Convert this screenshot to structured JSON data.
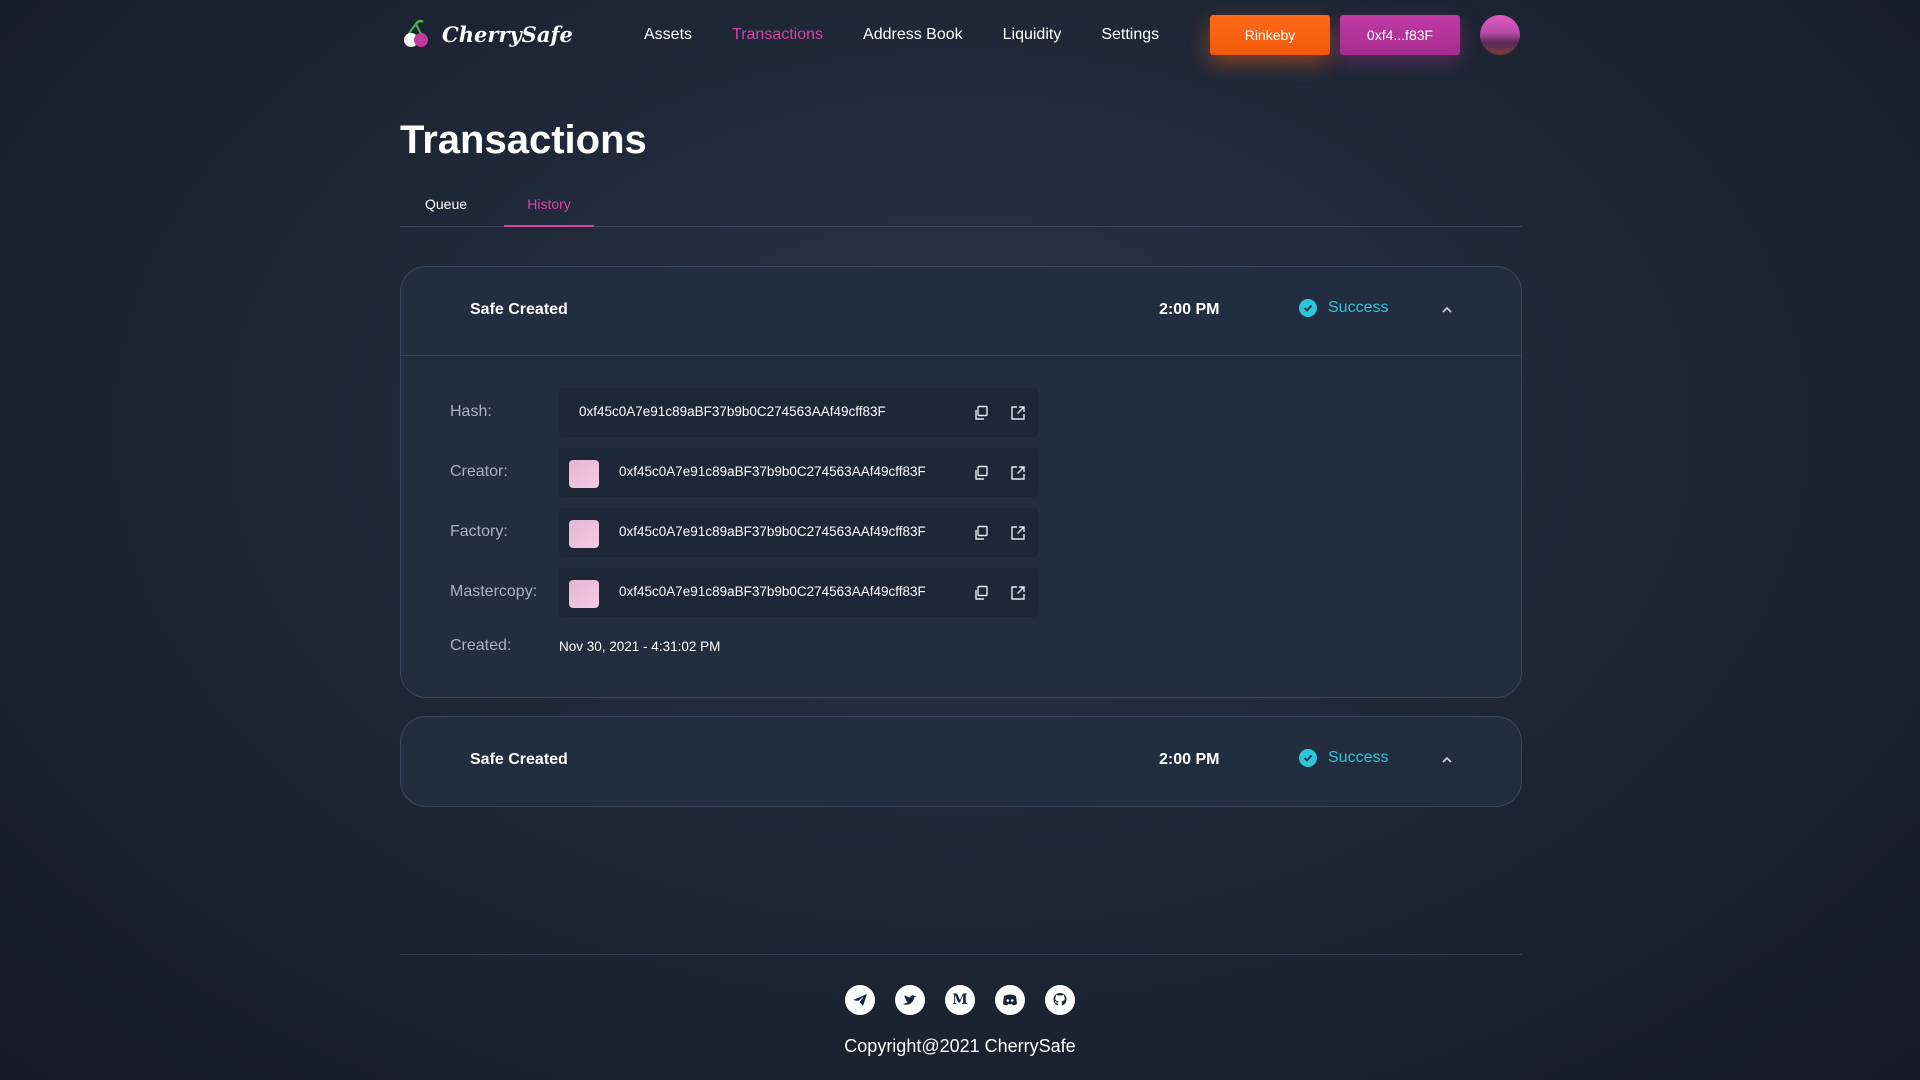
{
  "brand": {
    "name": "CherrySafe"
  },
  "nav": {
    "items": [
      {
        "label": "Assets",
        "active": false
      },
      {
        "label": "Transactions",
        "active": true
      },
      {
        "label": "Address Book",
        "active": false
      },
      {
        "label": "Liquidity",
        "active": false
      },
      {
        "label": "Settings",
        "active": false
      }
    ],
    "network_label": "Rinkeby",
    "wallet_label": "0xf4...f83F"
  },
  "page": {
    "title": "Transactions"
  },
  "tabs": [
    {
      "label": "Queue",
      "active": false
    },
    {
      "label": "History",
      "active": true
    }
  ],
  "transactions": [
    {
      "title": "Safe Created",
      "time": "2:00 PM",
      "status": "Success",
      "expanded": true,
      "details": {
        "hash_label": "Hash:",
        "hash": "0xf45c0A7e91c89aBF37b9b0C274563AAf49cff83F",
        "creator_label": "Creator:",
        "creator": "0xf45c0A7e91c89aBF37b9b0C274563AAf49cff83F",
        "factory_label": "Factory:",
        "factory": "0xf45c0A7e91c89aBF37b9b0C274563AAf49cff83F",
        "mastercopy_label": "Mastercopy:",
        "mastercopy": "0xf45c0A7e91c89aBF37b9b0C274563AAf49cff83F",
        "created_label": "Created:",
        "created": "Nov 30, 2021 - 4:31:02 PM"
      }
    },
    {
      "title": "Safe Created",
      "time": "2:00 PM",
      "status": "Success",
      "expanded": false
    }
  ],
  "footer": {
    "socials": [
      "telegram-icon",
      "twitter-icon",
      "medium-icon",
      "discord-icon",
      "github-icon"
    ],
    "copyright": "Copyright@2021 CherrySafe"
  },
  "colors": {
    "accent": "#d844a6",
    "success": "#2fc6d9",
    "network": "#f05a0c"
  }
}
